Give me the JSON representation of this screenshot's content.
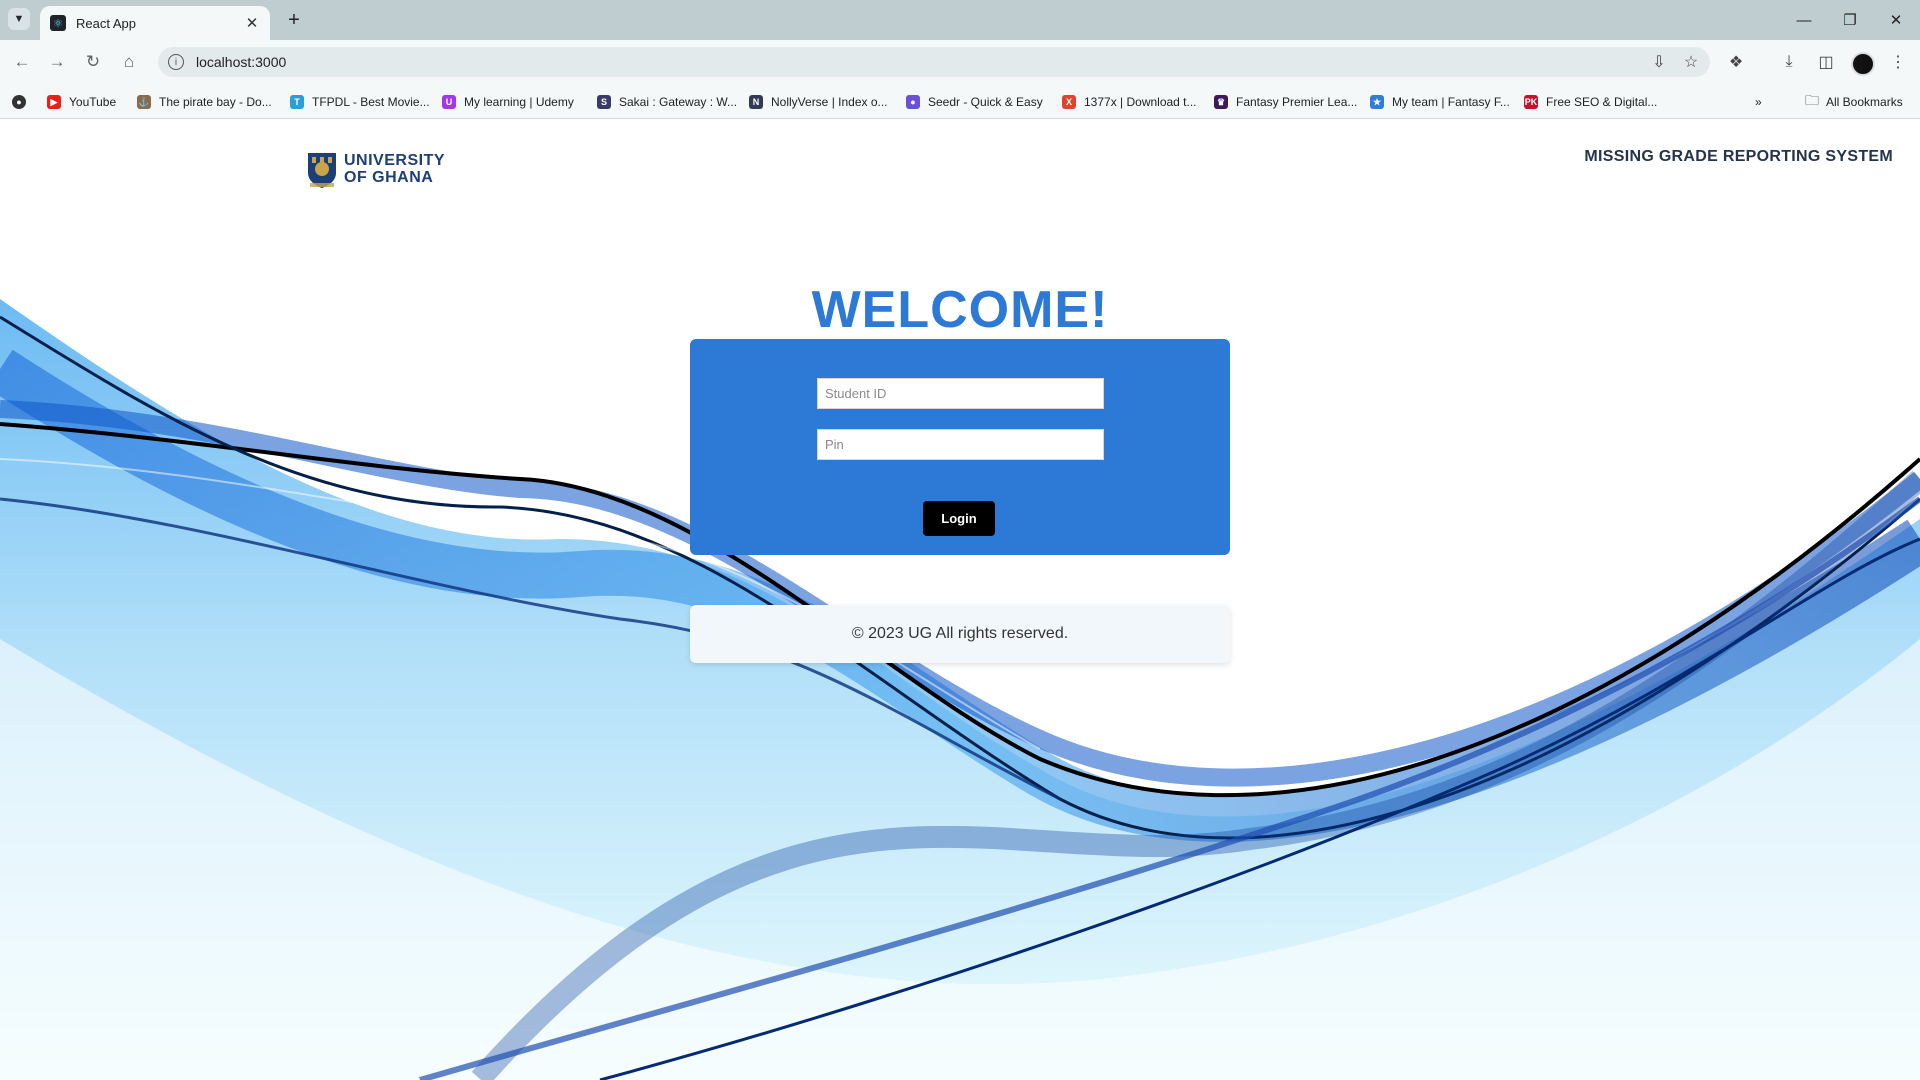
{
  "browser": {
    "tab": {
      "title": "React App",
      "favicon": "react-logo-icon"
    },
    "address": "localhost:3000",
    "bookmarks": [
      {
        "label": "YouTube",
        "icon": "youtube-icon",
        "color": "#e62117"
      },
      {
        "label": "The pirate bay - Do...",
        "icon": "pirate-ship-icon",
        "color": "#8a6a4a"
      },
      {
        "label": "TFPDL - Best Movie...",
        "icon": "tfpdl-icon",
        "color": "#2a9fd6"
      },
      {
        "label": "My learning | Udemy",
        "icon": "udemy-icon",
        "color": "#a435f0"
      },
      {
        "label": "Sakai : Gateway : W...",
        "icon": "sakai-icon",
        "color": "#3a3a6a"
      },
      {
        "label": "NollyVerse | Index o...",
        "icon": "nollyverse-icon",
        "color": "#333a55"
      },
      {
        "label": "Seedr - Quick & Easy",
        "icon": "seedr-icon",
        "color": "#6b4fd8"
      },
      {
        "label": "1377x | Download t...",
        "icon": "1377x-icon",
        "color": "#e0422d"
      },
      {
        "label": "Fantasy Premier Lea...",
        "icon": "premier-league-icon",
        "color": "#3d195b"
      },
      {
        "label": "My team | Fantasy F...",
        "icon": "fantasy-star-icon",
        "color": "#2f7fd8"
      },
      {
        "label": "Free SEO & Digital...",
        "icon": "pk-icon",
        "color": "#c8102e"
      }
    ],
    "all_bookmarks": "All Bookmarks"
  },
  "header": {
    "logo_line1": "UNIVERSITY",
    "logo_line2": "OF GHANA",
    "system_title": "MISSING GRADE REPORTING SYSTEM"
  },
  "login": {
    "heading": "WELCOME!",
    "student_id_placeholder": "Student ID",
    "pin_placeholder": "Pin",
    "button_label": "Login"
  },
  "footer": {
    "text": "© 2023 UG All rights reserved."
  },
  "colors": {
    "accent": "#2d7ad6",
    "button": "#000000",
    "logo": "#1d3f78"
  }
}
